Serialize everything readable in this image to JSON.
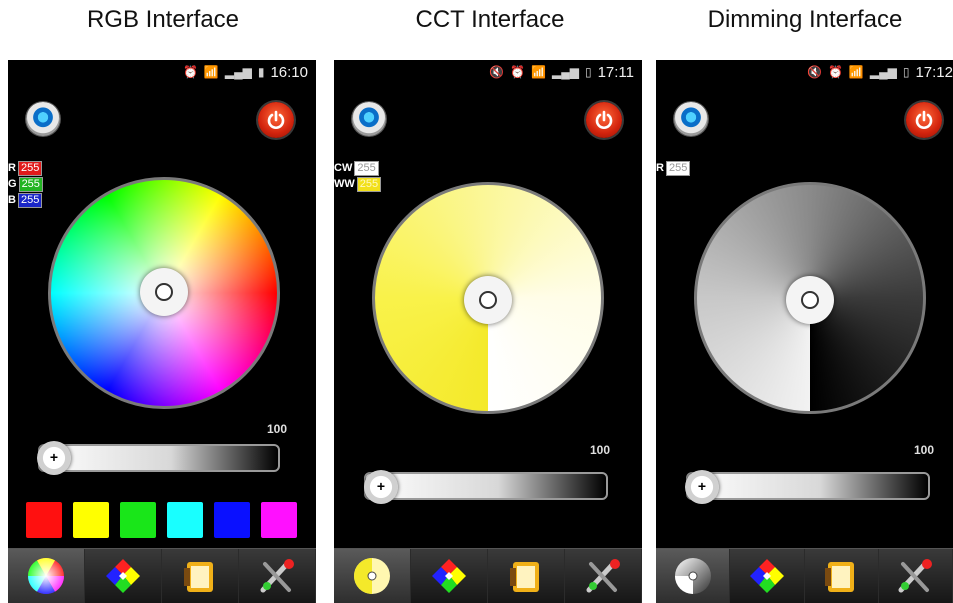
{
  "captions": [
    "RGB Interface",
    "CCT Interface",
    "Dimming Interface"
  ],
  "phones": [
    {
      "time": "16:10",
      "status_icons": [
        "alarm-icon",
        "wifi-icon",
        "4glte-icon",
        "signal-icon",
        "battery-icon"
      ],
      "channels": [
        {
          "label": "R",
          "value": "255",
          "color": "#e01b1b"
        },
        {
          "label": "G",
          "value": "255",
          "color": "#22b422"
        },
        {
          "label": "B",
          "value": "255",
          "color": "#1a26c8"
        }
      ],
      "slider_value": "100",
      "swatches": [
        "#ff1010",
        "#ffff00",
        "#19e619",
        "#19ffff",
        "#0a10ff",
        "#ff10ff"
      ],
      "active_tab": "color-wheel"
    },
    {
      "time": "17:11",
      "status_icons": [
        "mute-icon",
        "alarm-icon",
        "wifi-icon",
        "4glte-icon",
        "signal-icon",
        "battery-icon"
      ],
      "channels": [
        {
          "label": "CW",
          "value": "255",
          "color": "#ffffff"
        },
        {
          "label": "WW",
          "value": "255",
          "color": "#f2e01a"
        }
      ],
      "slider_value": "100",
      "active_tab": "cct-wheel"
    },
    {
      "time": "17:12",
      "status_icons": [
        "mute-icon",
        "alarm-icon",
        "wifi-icon",
        "4glte-icon",
        "signal-icon",
        "battery-icon"
      ],
      "channels": [
        {
          "label": "R",
          "value": "255",
          "color": "#ffffff"
        }
      ],
      "slider_value": "100",
      "active_tab": "dimming-wheel"
    }
  ],
  "tabs": [
    "wheel-icon",
    "scene-icon",
    "music-film-icon",
    "settings-tools-icon"
  ]
}
